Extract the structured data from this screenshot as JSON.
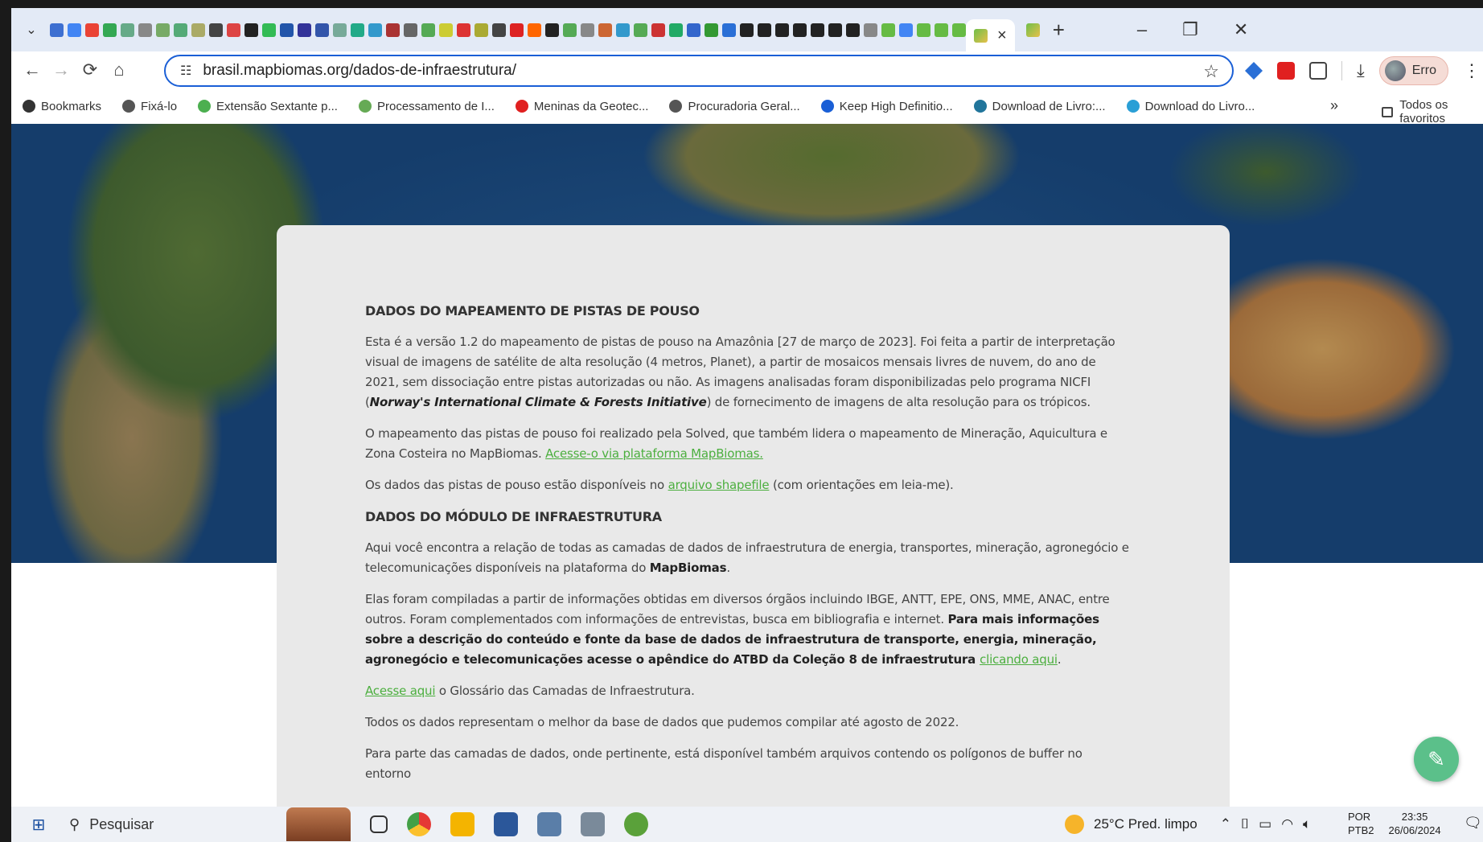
{
  "browser": {
    "tab_close": "×",
    "new_tab": "+",
    "win_minimize": "–",
    "win_restore": "❐",
    "win_close": "✕",
    "url": "brasil.mapbiomas.org/dados-de-infraestrutura/",
    "profile_label": "Erro"
  },
  "bookmarks": {
    "items": [
      {
        "label": "Bookmarks",
        "icon": "star-icon"
      },
      {
        "label": "Fixá-lo",
        "icon": "globe-icon"
      },
      {
        "label": "Extensão Sextante p...",
        "icon": "layers-icon"
      },
      {
        "label": "Processamento de I...",
        "icon": "document-icon"
      },
      {
        "label": "Meninas da Geotec...",
        "icon": "youtube-icon"
      },
      {
        "label": "Procuradoria Geral...",
        "icon": "globe-icon"
      },
      {
        "label": "Keep High Definitio...",
        "icon": "s-logo-icon"
      },
      {
        "label": "Download de Livro:...",
        "icon": "wordpress-icon"
      },
      {
        "label": "Download do Livro...",
        "icon": "edge-icon"
      }
    ],
    "more": "»",
    "folder_label": "Todos os favoritos"
  },
  "article": {
    "h_pistas": "DADOS DO MAPEAMENTO DE PISTAS DE POUSO",
    "p1_a": "Esta é a versão 1.2 do mapeamento de pistas de pouso na Amazônia [27 de março de 2023]. Foi feita a partir de interpretação visual de imagens de satélite de alta resolução (4 metros, Planet), a partir de mosaicos mensais livres de nuvem, do ano de 2021, sem dissociação entre pistas autorizadas ou não. As imagens analisadas foram disponibilizadas pelo programa NICFI (",
    "p1_em": "Norway's International Climate & Forests Initiative",
    "p1_b": ") de fornecimento de imagens de alta resolução para os trópicos.",
    "p2_a": "O mapeamento das pistas de pouso foi realizado pela Solved, que também lidera o mapeamento de Mineração, Aquicultura e Zona Costeira no MapBiomas. ",
    "p2_link": "Acesse-o via plataforma MapBiomas.",
    "p3_a": "Os dados das pistas de pouso estão disponíveis no ",
    "p3_link": "arquivo shapefile",
    "p3_b": " (com orientações em leia-me).",
    "h_modulo": "DADOS DO MÓDULO DE INFRAESTRUTURA",
    "p4_a": "Aqui você encontra a relação de todas as camadas de dados de infraestrutura de energia, transportes, mineração, agronegócio e telecomunicações disponíveis na plataforma do ",
    "p4_bold": "MapBiomas",
    "p4_b": ".",
    "p5_a": "Elas foram compiladas a partir de informações obtidas em diversos órgãos incluindo IBGE, ANTT, EPE, ONS, MME, ANAC, entre outros. Foram complementados com informações de entrevistas, busca em bibliografia e internet. ",
    "p5_bold": "Para mais informações sobre a descrição do conteúdo e fonte da base de dados de infraestrutura de transporte, energia, mineração, agronegócio e telecomunicações acesse o apêndice do ATBD da Coleção 8 de infraestrutura ",
    "p5_link": "clicando aqui",
    "p5_b": ".",
    "p6_link": "Acesse aqui",
    "p6_b": " o Glossário das Camadas de Infraestrutura.",
    "p7": "Todos os dados representam o melhor da base de dados que pudemos compilar até agosto de 2022.",
    "p8": "Para parte das camadas de dados, onde pertinente, está disponível também arquivos contendo os polígonos de buffer no entorno"
  },
  "taskbar": {
    "search_label": "Pesquisar",
    "weather": "25°C  Pred. limpo",
    "lang_top": "POR",
    "lang_bottom": "PTB2",
    "time": "23:35",
    "date": "26/06/2024"
  }
}
